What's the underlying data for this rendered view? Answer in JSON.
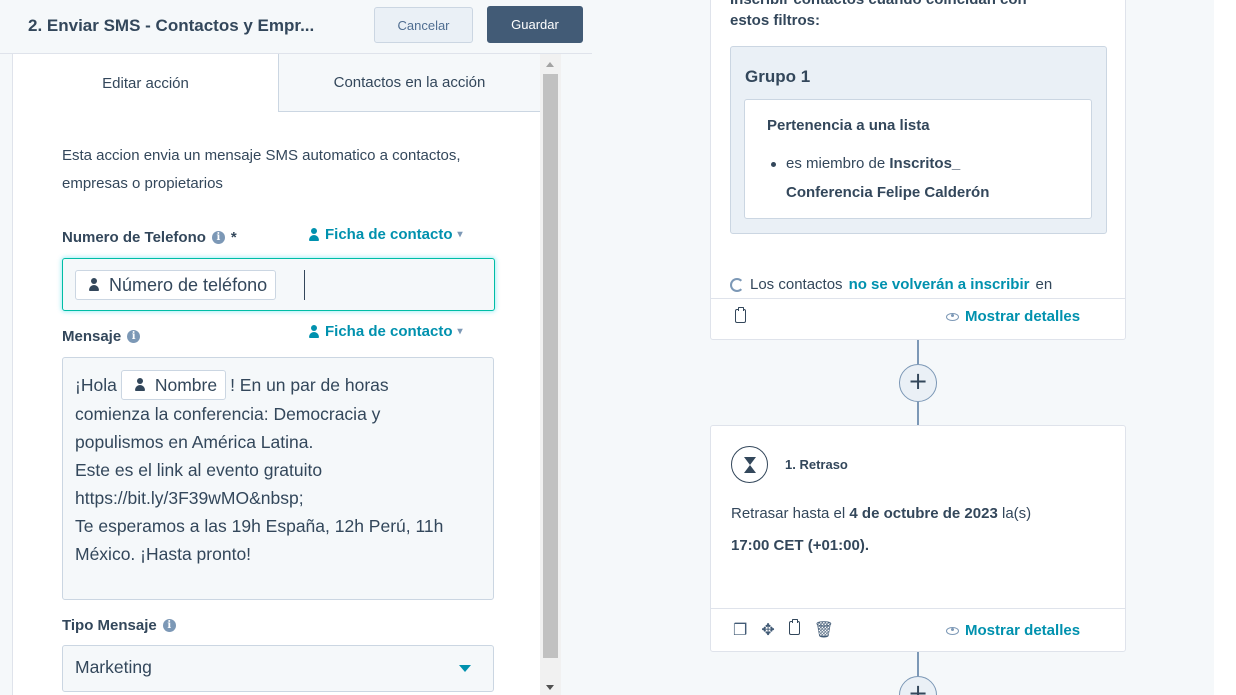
{
  "header": {
    "title": "2. Enviar SMS - Contactos y Empr...",
    "cancel_label": "Cancelar",
    "save_label": "Guardar"
  },
  "tabs": [
    {
      "label": "Editar acción",
      "active": true
    },
    {
      "label": "Contactos en la acción",
      "active": false
    }
  ],
  "form": {
    "description": "Esta accion envia un mensaje SMS automatico a contactos, empresas o propietarios",
    "phone": {
      "label": "Numero de Telefono",
      "required_mark": "*",
      "source_label": "Ficha de contacto",
      "token_label": "Número de teléfono"
    },
    "message": {
      "label": "Mensaje",
      "source_label": "Ficha de contacto",
      "prefix": "¡Hola",
      "token_label": "Nombre",
      "suffix": "! En un par de horas",
      "lines": [
        "comienza la conferencia: Democracia y",
        "populismos en América Latina.",
        "Este es el link al evento gratuito",
        "https://bit.ly/3F39wMO&nbsp;",
        "Te esperamos a las 19h España, 12h Perú, 11h",
        "México. ¡Hasta pronto!"
      ]
    },
    "message_type": {
      "label": "Tipo Mensaje",
      "selected": "Marketing"
    }
  },
  "canvas": {
    "enroll_card": {
      "cut_text": "Inscribir contactos cuando coincidan con",
      "filter_title": "estos filtros:",
      "group_title": "Grupo 1",
      "filter_name": "Pertenencia a una lista",
      "filter_prefix": "es miembro de",
      "filter_value_1": "Inscritos_",
      "filter_value_2": "Conferencia Felipe Calderón",
      "reenroll_prefix": "Los contactos",
      "reenroll_bold": "no se volverán a inscribir",
      "reenroll_suffix": "en",
      "show_details": "Mostrar detalles"
    },
    "add_symbol": "+",
    "delay_card": {
      "title": "1. Retraso",
      "text_prefix": "Retrasar hasta el",
      "date": "4 de octubre de 2023",
      "text_suffix": "la(s)",
      "time": "17:00 CET (+01:00)",
      "time_suffix": ".",
      "show_details": "Mostrar detalles"
    }
  },
  "icons": {
    "info": "info-icon",
    "person": "person-icon",
    "refresh": "refresh-icon",
    "clipboard": "clipboard-icon",
    "eye": "eye-icon",
    "hourglass": "hourglass-icon",
    "copy": "copy-icon",
    "move": "move-icon",
    "trash": "trash-icon"
  },
  "colors": {
    "accent": "#0091ae",
    "primary_button": "#425b76",
    "focus_border": "#00bda5",
    "text": "#33475b"
  }
}
